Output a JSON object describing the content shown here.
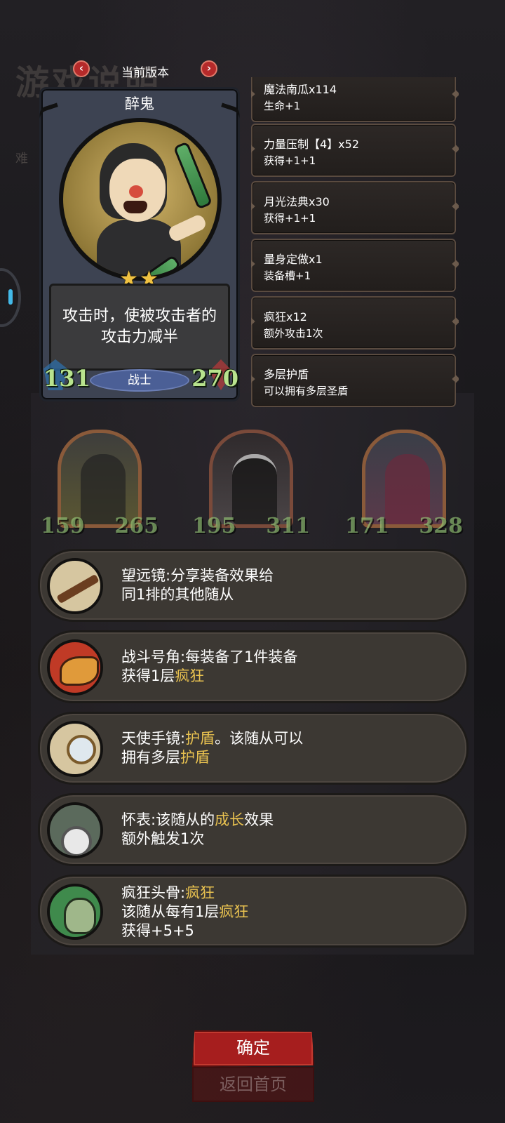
{
  "background": {
    "title_fragment": "游戏说明",
    "subtitle_fragment": "难"
  },
  "version_nav": {
    "prev_icon": "chevron-left-icon",
    "label": "当前版本",
    "next_icon": "chevron-right-icon"
  },
  "hero": {
    "name": "醉鬼",
    "stars": "★★",
    "star_count": 2,
    "ability": "攻击时，使被攻击者的攻击力减半",
    "attack": "131",
    "health": "270",
    "class": "战士"
  },
  "equipment": [
    {
      "name": "魔法南瓜x114",
      "effect": "生命+1"
    },
    {
      "name": "力量压制【4】x52",
      "effect": "获得+1+1"
    },
    {
      "name": "月光法典x30",
      "effect": "获得+1+1"
    },
    {
      "name": "量身定做x1",
      "effect": "装备槽+1"
    },
    {
      "name": "疯狂x12",
      "effect": "额外攻击1次"
    },
    {
      "name": "多层护盾",
      "effect": "可以拥有多层圣盾"
    }
  ],
  "minions": [
    {
      "attack": "159",
      "health": "265",
      "icon": "robot-portrait-icon"
    },
    {
      "attack": "195",
      "health": "311",
      "icon": "cat-portrait-icon"
    },
    {
      "attack": "171",
      "health": "328",
      "icon": "elf-portrait-icon"
    }
  ],
  "trinkets": [
    {
      "icon": "telescope-icon",
      "line1": "望远镜:分享装备效果给",
      "line2": "同1排的其他随从"
    },
    {
      "icon": "war-horn-icon",
      "line1": "战斗号角:每装备了1件装备",
      "line2_pre": "获得1层",
      "line2_hl": "疯狂"
    },
    {
      "icon": "hand-mirror-icon",
      "line1_pre": "天使手镜:",
      "line1_hl": "护盾",
      "line1_post": "。该随从可以",
      "line2_pre": "拥有多层",
      "line2_hl": "护盾"
    },
    {
      "icon": "pocket-watch-icon",
      "line1_pre": "怀表:该随从的",
      "line1_hl": "成长",
      "line1_post": "效果",
      "line2": "额外触发1次"
    },
    {
      "icon": "mad-skull-icon",
      "line1_pre": "疯狂头骨:",
      "line1_hl": "疯狂",
      "line2_pre": "该随从每有1层",
      "line2_hl": "疯狂",
      "line3": "获得+5+5"
    }
  ],
  "buttons": {
    "confirm": "确定",
    "home": "返回首页"
  },
  "colors": {
    "highlight": "#e9c250",
    "stat_green": "#b8e38e",
    "class_badge": "#4b5f96",
    "button_red": "#a61e1e"
  }
}
